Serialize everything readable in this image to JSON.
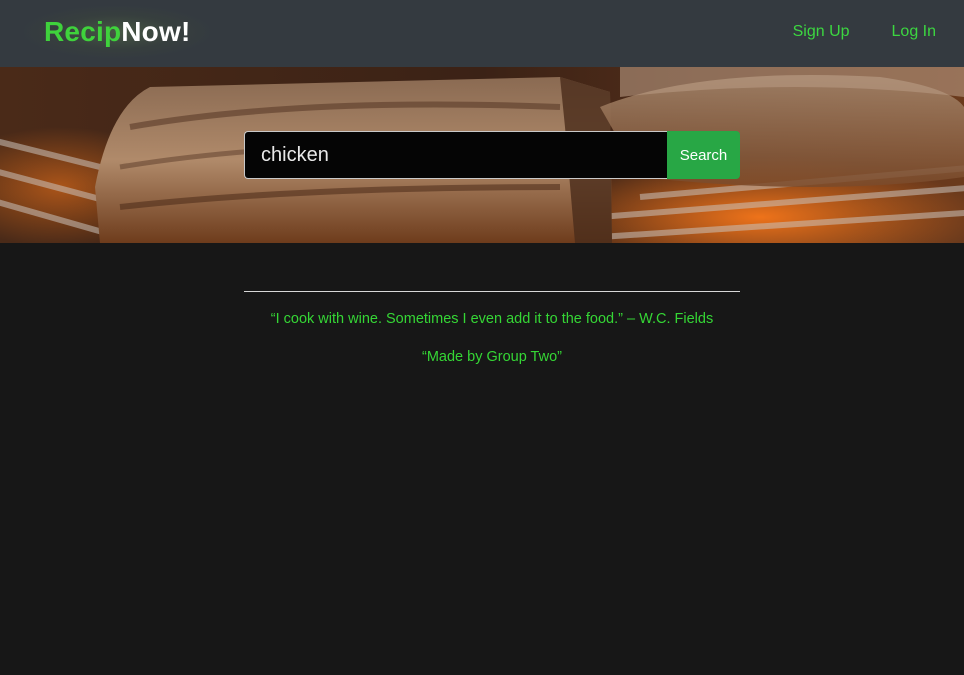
{
  "navbar": {
    "brand_part1": "Recip",
    "brand_part2": "Now!",
    "links": [
      {
        "label": "Sign Up"
      },
      {
        "label": "Log In"
      }
    ]
  },
  "hero": {
    "search": {
      "value": "chicken",
      "placeholder": "",
      "button_label": "Search"
    }
  },
  "footer": {
    "quote": "“I cook with wine. Sometimes I even add it to the food.” – W.C. Fields",
    "credit": "“Made by Group Two”"
  },
  "colors": {
    "accent_green": "#28a745",
    "text_green": "#35d635",
    "navbar_bg": "#343a40",
    "page_bg": "#171717"
  }
}
